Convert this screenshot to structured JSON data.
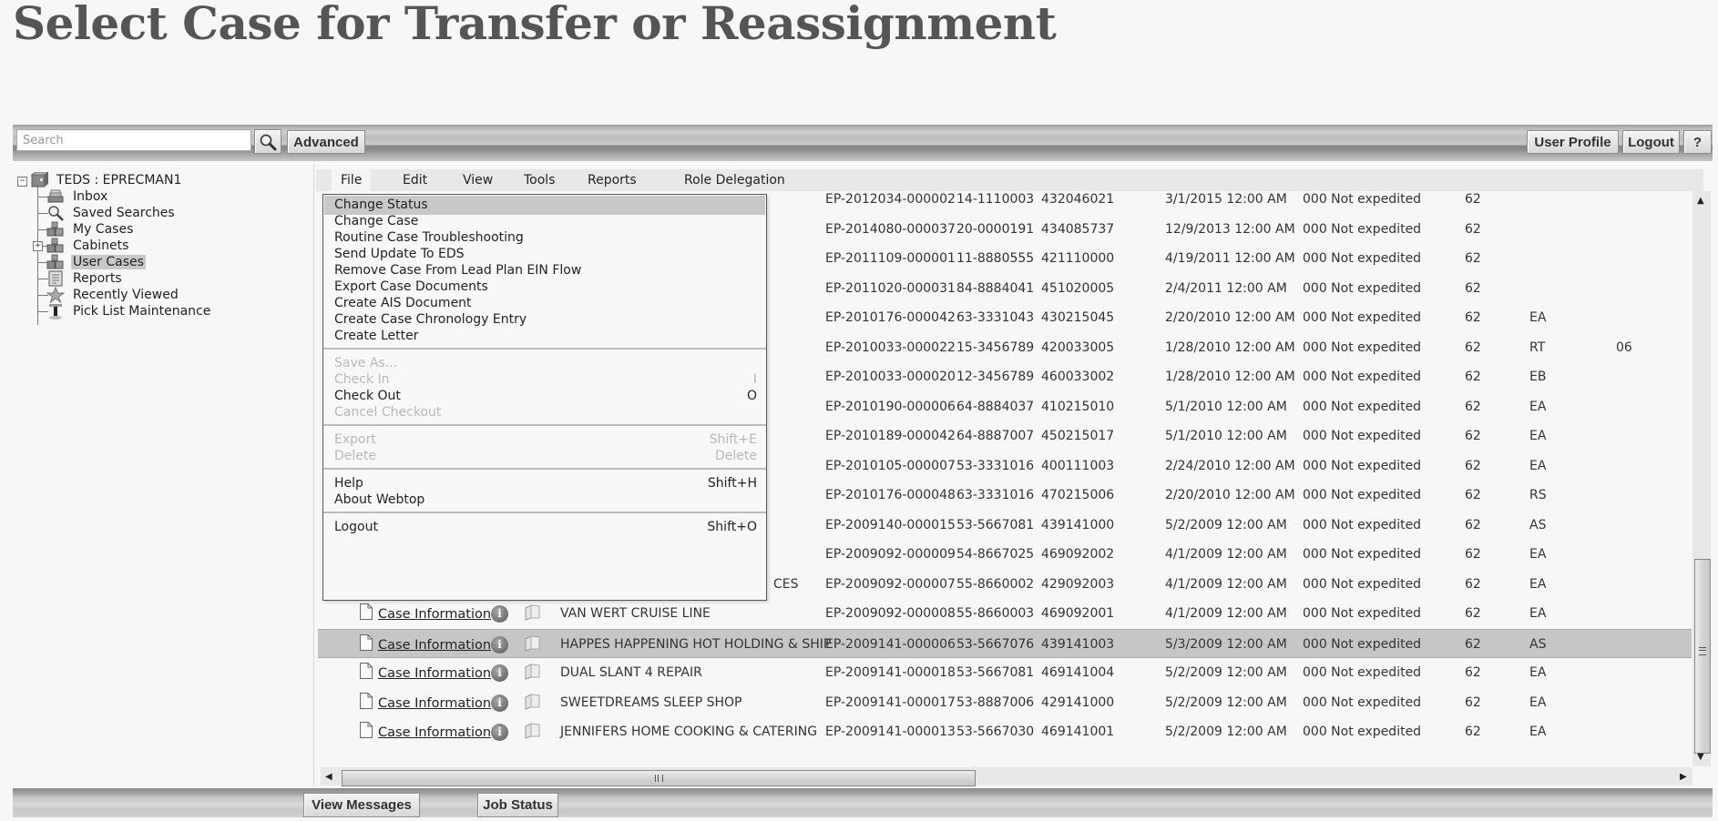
{
  "page_title": "Select Case for Transfer or Reassignment",
  "toolbar": {
    "search_placeholder": "Search",
    "search_icon": "magnifier-icon",
    "advanced_label": "Advanced",
    "user_profile_label": "User Profile",
    "logout_label": "Logout",
    "help_label": "?"
  },
  "tree": {
    "root": {
      "label": "TEDS : EPRECMAN1",
      "icon": "repository-icon",
      "expanded": true
    },
    "items": [
      {
        "label": "Inbox",
        "icon": "inbox-icon"
      },
      {
        "label": "Saved Searches",
        "icon": "magnifier-icon"
      },
      {
        "label": "My Cases",
        "icon": "cabinet-icon"
      },
      {
        "label": "Cabinets",
        "icon": "cabinet-icon",
        "collapsed": true
      },
      {
        "label": "User Cases",
        "icon": "cabinet-icon",
        "selected": true
      },
      {
        "label": "Reports",
        "icon": "report-icon"
      },
      {
        "label": "Recently Viewed",
        "icon": "star-icon"
      },
      {
        "label": "Pick List Maintenance",
        "icon": "tool-icon"
      }
    ]
  },
  "menubar": [
    "File",
    "Edit",
    "View",
    "Tools",
    "Reports",
    "Role Delegation"
  ],
  "file_menu": {
    "groups": [
      [
        {
          "label": "Change Status",
          "shortcut": "",
          "enabled": true,
          "active": true
        },
        {
          "label": "Change Case",
          "shortcut": "",
          "enabled": true
        },
        {
          "label": "Routine Case Troubleshooting",
          "shortcut": "",
          "enabled": true
        },
        {
          "label": "Send Update To EDS",
          "shortcut": "",
          "enabled": true
        },
        {
          "label": "Remove Case From Lead Plan EIN Flow",
          "shortcut": "",
          "enabled": true
        },
        {
          "label": "Export Case Documents",
          "shortcut": "",
          "enabled": true
        },
        {
          "label": "Create AIS Document",
          "shortcut": "",
          "enabled": true
        },
        {
          "label": "Create Case Chronology Entry",
          "shortcut": "",
          "enabled": true
        },
        {
          "label": "Create Letter",
          "shortcut": "",
          "enabled": true
        }
      ],
      [
        {
          "label": "Save As...",
          "shortcut": "",
          "enabled": false
        },
        {
          "label": "Check In",
          "shortcut": "I",
          "enabled": false
        },
        {
          "label": "Check Out",
          "shortcut": "O",
          "enabled": true
        },
        {
          "label": "Cancel Checkout",
          "shortcut": "",
          "enabled": false
        }
      ],
      [
        {
          "label": "Export",
          "shortcut": "Shift+E",
          "enabled": false
        },
        {
          "label": "Delete",
          "shortcut": "Delete",
          "enabled": false
        }
      ],
      [
        {
          "label": "Help",
          "shortcut": "Shift+H",
          "enabled": true
        },
        {
          "label": "About Webtop",
          "shortcut": "",
          "enabled": true
        }
      ],
      [
        {
          "label": "Logout",
          "shortcut": "Shift+O",
          "enabled": true
        }
      ]
    ]
  },
  "table": {
    "link_label": "Case Information",
    "rows": [
      {
        "name": "",
        "case": "EP-2012034-000002",
        "ein": "14-1110003",
        "plan": "432046021",
        "date": "3/1/2015 12:00 AM",
        "status": "000 Not expedited",
        "num": "62",
        "code": "",
        "extra": "",
        "show_link": false
      },
      {
        "name": "",
        "case": "EP-2014080-000037",
        "ein": "20-0000191",
        "plan": "434085737",
        "date": "12/9/2013 12:00 AM",
        "status": "000 Not expedited",
        "num": "62",
        "code": "",
        "extra": "",
        "show_link": false
      },
      {
        "name": "",
        "case": "EP-2011109-000001",
        "ein": "11-8880555",
        "plan": "421110000",
        "date": "4/19/2011 12:00 AM",
        "status": "000 Not expedited",
        "num": "62",
        "code": "",
        "extra": "",
        "show_link": false
      },
      {
        "name": "",
        "case": "EP-2011020-000031",
        "ein": "84-8884041",
        "plan": "451020005",
        "date": "2/4/2011 12:00 AM",
        "status": "000 Not expedited",
        "num": "62",
        "code": "",
        "extra": "",
        "show_link": false
      },
      {
        "name": "",
        "case": "EP-2010176-000042",
        "ein": "63-3331043",
        "plan": "430215045",
        "date": "2/20/2010 12:00 AM",
        "status": "000 Not expedited",
        "num": "62",
        "code": "EA",
        "extra": "",
        "show_link": false
      },
      {
        "name": "",
        "case": "EP-2010033-000022",
        "ein": "15-3456789",
        "plan": "420033005",
        "date": "1/28/2010 12:00 AM",
        "status": "000 Not expedited",
        "num": "62",
        "code": "RT",
        "extra": "06",
        "show_link": false
      },
      {
        "name": "",
        "case": "EP-2010033-000020",
        "ein": "12-3456789",
        "plan": "460033002",
        "date": "1/28/2010 12:00 AM",
        "status": "000 Not expedited",
        "num": "62",
        "code": "EB",
        "extra": "",
        "show_link": false
      },
      {
        "name": "",
        "case": "EP-2010190-000006",
        "ein": "64-8884037",
        "plan": "410215010",
        "date": "5/1/2010 12:00 AM",
        "status": "000 Not expedited",
        "num": "62",
        "code": "EA",
        "extra": "",
        "show_link": false
      },
      {
        "name": "",
        "case": "EP-2010189-000042",
        "ein": "64-8887007",
        "plan": "450215017",
        "date": "5/1/2010 12:00 AM",
        "status": "000 Not expedited",
        "num": "62",
        "code": "EA",
        "extra": "",
        "show_link": false
      },
      {
        "name": "",
        "case": "EP-2010105-000007",
        "ein": "53-3331016",
        "plan": "400111003",
        "date": "2/24/2010 12:00 AM",
        "status": "000 Not expedited",
        "num": "62",
        "code": "EA",
        "extra": "",
        "show_link": false
      },
      {
        "name": "",
        "case": "EP-2010176-000048",
        "ein": "63-3331016",
        "plan": "470215006",
        "date": "2/20/2010 12:00 AM",
        "status": "000 Not expedited",
        "num": "62",
        "code": "RS",
        "extra": "",
        "show_link": false
      },
      {
        "name": "",
        "case": "EP-2009140-000015",
        "ein": "53-5667081",
        "plan": "439141000",
        "date": "5/2/2009 12:00 AM",
        "status": "000 Not expedited",
        "num": "62",
        "code": "AS",
        "extra": "",
        "show_link": false
      },
      {
        "name": "",
        "case": "EP-2009092-000009",
        "ein": "54-8667025",
        "plan": "469092002",
        "date": "4/1/2009 12:00 AM",
        "status": "000 Not expedited",
        "num": "62",
        "code": "EA",
        "extra": "",
        "show_link": false
      },
      {
        "name": "CES",
        "case": "EP-2009092-000007",
        "ein": "55-8660002",
        "plan": "429092003",
        "date": "4/1/2009 12:00 AM",
        "status": "000 Not expedited",
        "num": "62",
        "code": "EA",
        "extra": "",
        "show_link": false
      },
      {
        "name": "VAN WERT CRUISE LINE",
        "case": "EP-2009092-000008",
        "ein": "55-8660003",
        "plan": "469092001",
        "date": "4/1/2009 12:00 AM",
        "status": "000 Not expedited",
        "num": "62",
        "code": "EA",
        "extra": "",
        "show_link": true
      },
      {
        "name": "HAPPES HAPPENING HOT HOLDING & SHIP",
        "case": "EP-2009141-000006",
        "ein": "53-5667076",
        "plan": "439141003",
        "date": "5/3/2009 12:00 AM",
        "status": "000 Not expedited",
        "num": "62",
        "code": "AS",
        "extra": "",
        "show_link": true,
        "selected": true
      },
      {
        "name": "DUAL SLANT 4 REPAIR",
        "case": "EP-2009141-000018",
        "ein": "53-5667081",
        "plan": "469141004",
        "date": "5/2/2009 12:00 AM",
        "status": "000 Not expedited",
        "num": "62",
        "code": "EA",
        "extra": "",
        "show_link": true
      },
      {
        "name": "SWEETDREAMS SLEEP SHOP",
        "case": "EP-2009141-000017",
        "ein": "53-8887006",
        "plan": "429141000",
        "date": "5/2/2009 12:00 AM",
        "status": "000 Not expedited",
        "num": "62",
        "code": "EA",
        "extra": "",
        "show_link": true
      },
      {
        "name": "JENNIFERS HOME COOKING & CATERING",
        "case": "EP-2009141-000013",
        "ein": "53-5667030",
        "plan": "469141001",
        "date": "5/2/2009 12:00 AM",
        "status": "000 Not expedited",
        "num": "62",
        "code": "EA",
        "extra": "",
        "show_link": true
      }
    ]
  },
  "bottombar": {
    "view_messages_label": "View Messages",
    "job_status_label": "Job Status"
  }
}
